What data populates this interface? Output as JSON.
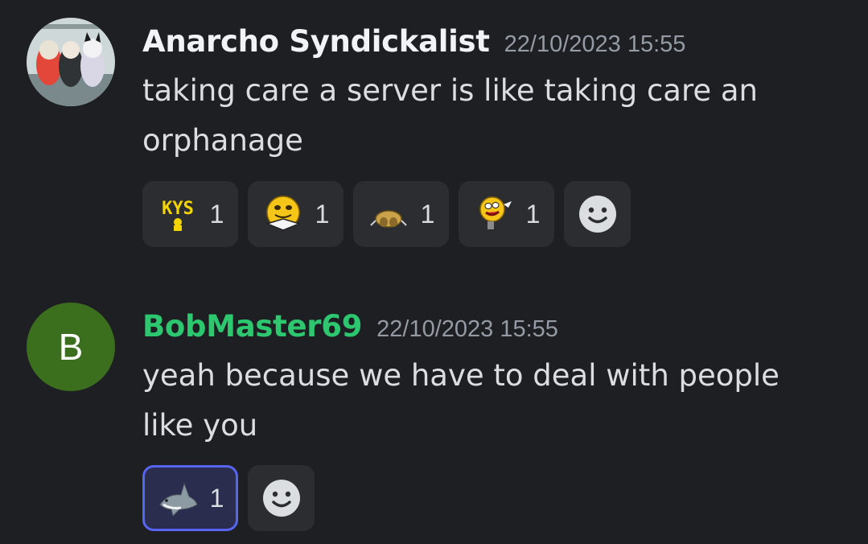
{
  "messages": [
    {
      "username": "Anarcho Syndickalist",
      "timestamp": "22/10/2023 15:55",
      "text": "taking care a server is like taking care an orphanage",
      "reactions": [
        {
          "emoji": "kys-text-emoji",
          "count": "1"
        },
        {
          "emoji": "yellow-smiley-reading-emoji",
          "count": "1"
        },
        {
          "emoji": "crawling-creature-emoji",
          "count": "1"
        },
        {
          "emoji": "yellow-smiley-pointing-emoji",
          "count": "1"
        }
      ]
    },
    {
      "username": "BobMaster69",
      "avatar_letter": "B",
      "timestamp": "22/10/2023 15:55",
      "text": "yeah because we have to deal with people like you",
      "reactions": [
        {
          "emoji": "shark-emoji",
          "count": "1"
        }
      ]
    }
  ],
  "emoji_labels": {
    "kys": "KYS"
  },
  "colors": {
    "background": "#1e1f23",
    "reaction_bg": "#2b2d31",
    "reaction_active_border": "#5865f2",
    "green_username": "#2dc770",
    "avatar_green": "#3b6e1d"
  }
}
